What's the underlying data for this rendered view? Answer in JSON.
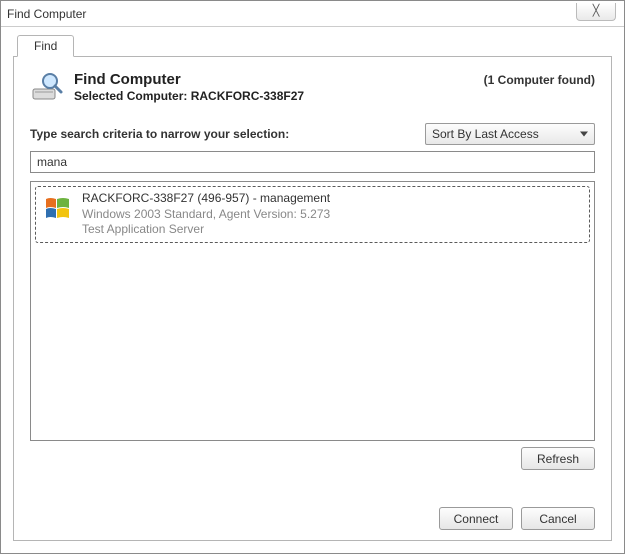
{
  "window": {
    "title": "Find Computer",
    "close_glyph": "╳"
  },
  "tab": {
    "label": "Find"
  },
  "header": {
    "title": "Find Computer",
    "selected_prefix": "Selected Computer: ",
    "selected_value": "RACKFORC-338F27",
    "found_text": "(1 Computer found)"
  },
  "criteria": {
    "label": "Type search criteria to narrow your selection:",
    "sort_selected": "Sort By Last Access"
  },
  "search": {
    "value": "mana"
  },
  "results": [
    {
      "title": "RACKFORC-338F27 (496-957) - management",
      "line2": "Windows 2003 Standard, Agent Version: 5.273",
      "line3": "Test Application Server"
    }
  ],
  "buttons": {
    "refresh": "Refresh",
    "connect": "Connect",
    "cancel": "Cancel"
  }
}
